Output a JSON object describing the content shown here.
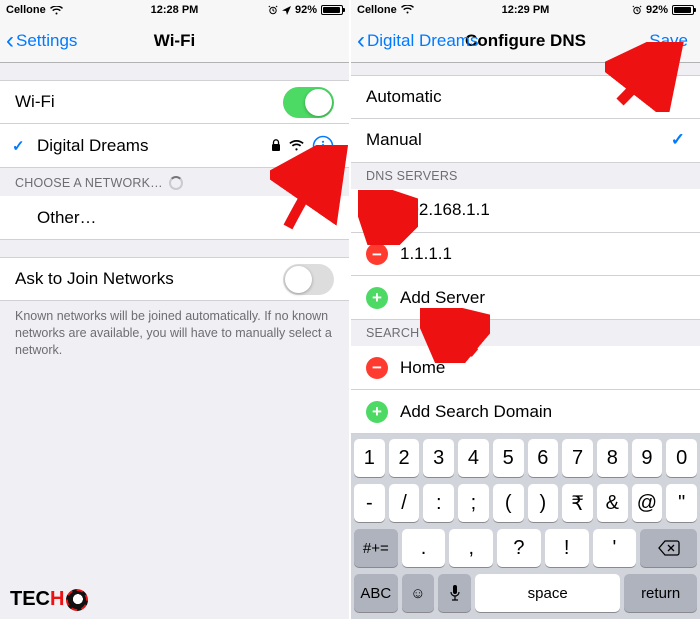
{
  "left": {
    "status": {
      "carrier": "Cellone",
      "time": "12:28 PM",
      "battery": "92%"
    },
    "nav": {
      "back": "Settings",
      "title": "Wi-Fi"
    },
    "wifi_row_label": "Wi-Fi",
    "connected_network": "Digital Dreams",
    "choose_header": "CHOOSE A NETWORK…",
    "other_label": "Other…",
    "ask_label": "Ask to Join Networks",
    "ask_footer": "Known networks will be joined automatically. If no known networks are available, you will have to manually select a network."
  },
  "right": {
    "status": {
      "carrier": "Cellone",
      "time": "12:29 PM",
      "battery": "92%"
    },
    "nav": {
      "back": "Digital Dreams",
      "title": "Configure DNS",
      "save": "Save"
    },
    "option_auto": "Automatic",
    "option_manual": "Manual",
    "dns_header": "DNS SERVERS",
    "dns_servers": [
      "192.168.1.1",
      "1.1.1.1"
    ],
    "add_server": "Add Server",
    "search_header": "SEARCH DOMAINS",
    "search_domains": [
      "Home"
    ],
    "add_domain": "Add Search Domain",
    "keyboard": {
      "row1": [
        "1",
        "2",
        "3",
        "4",
        "5",
        "6",
        "7",
        "8",
        "9",
        "0"
      ],
      "row2": [
        "-",
        "/",
        ":",
        ";",
        "(",
        ")",
        "₹",
        "&",
        "@",
        "\""
      ],
      "sym": "#+=",
      "row3": [
        ".",
        ",",
        "?",
        "!",
        "'"
      ],
      "abc": "ABC",
      "space": "space",
      "return": "return"
    }
  },
  "logo": {
    "text": "TEC",
    "red": "H"
  }
}
